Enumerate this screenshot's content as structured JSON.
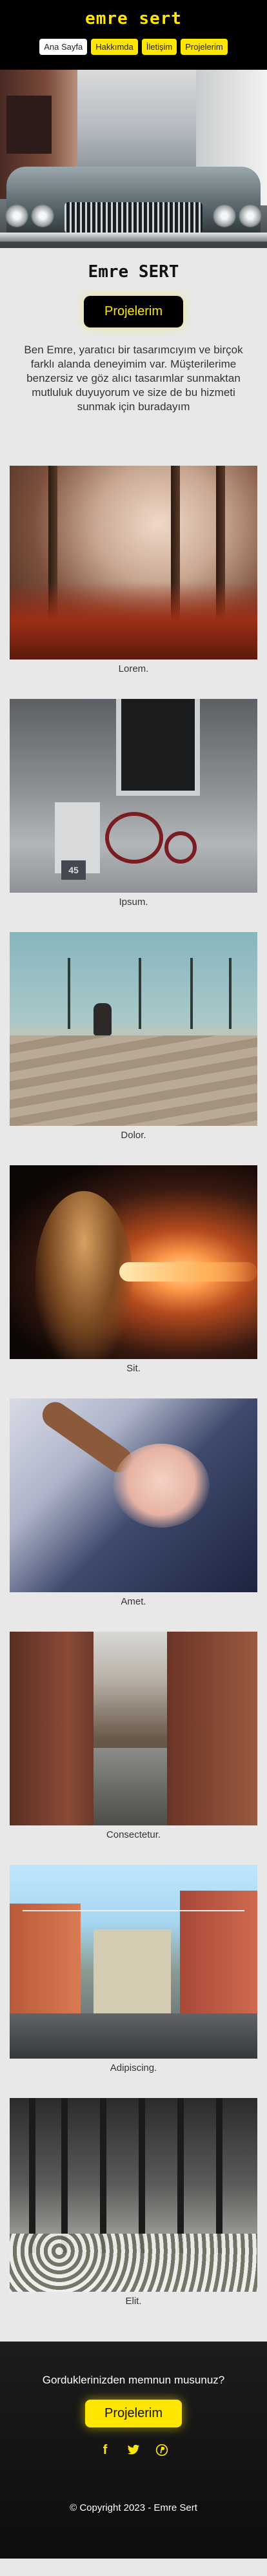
{
  "header": {
    "brand": "emre sert",
    "nav": [
      {
        "label": "Ana Sayfa",
        "highlight": false
      },
      {
        "label": "Hakkımda",
        "highlight": true
      },
      {
        "label": "İletişim",
        "highlight": true
      },
      {
        "label": "Projelerim",
        "highlight": true
      }
    ]
  },
  "about": {
    "title": "Emre SERT",
    "button": "Projelerim",
    "text": "Ben Emre, yaratıcı bir tasarımcıyım ve birçok farklı alanda deneyimim var. Müşterilerime benzersiz ve göz alıcı tasarımlar sunmaktan mutluluk duyuyorum ve size de bu hizmeti sunmak için buradayım"
  },
  "gallery": {
    "items": [
      {
        "caption": "Lorem."
      },
      {
        "caption": "Ipsum."
      },
      {
        "caption": "Dolor."
      },
      {
        "caption": "Sit."
      },
      {
        "caption": "Amet."
      },
      {
        "caption": "Consectetur."
      },
      {
        "caption": "Adipiscing."
      },
      {
        "caption": "Elit."
      }
    ],
    "sign_text": "45"
  },
  "footer": {
    "question": "Gorduklerinizden memnun musunuz?",
    "button": "Projelerim",
    "social": {
      "facebook": "f",
      "twitter": "🐦",
      "pinterest": "℗"
    },
    "copyright": "© Copyright 2023 - Emre Sert"
  },
  "colors": {
    "accent": "#ffe600",
    "dark": "#000000",
    "background": "#e8e8e8"
  }
}
